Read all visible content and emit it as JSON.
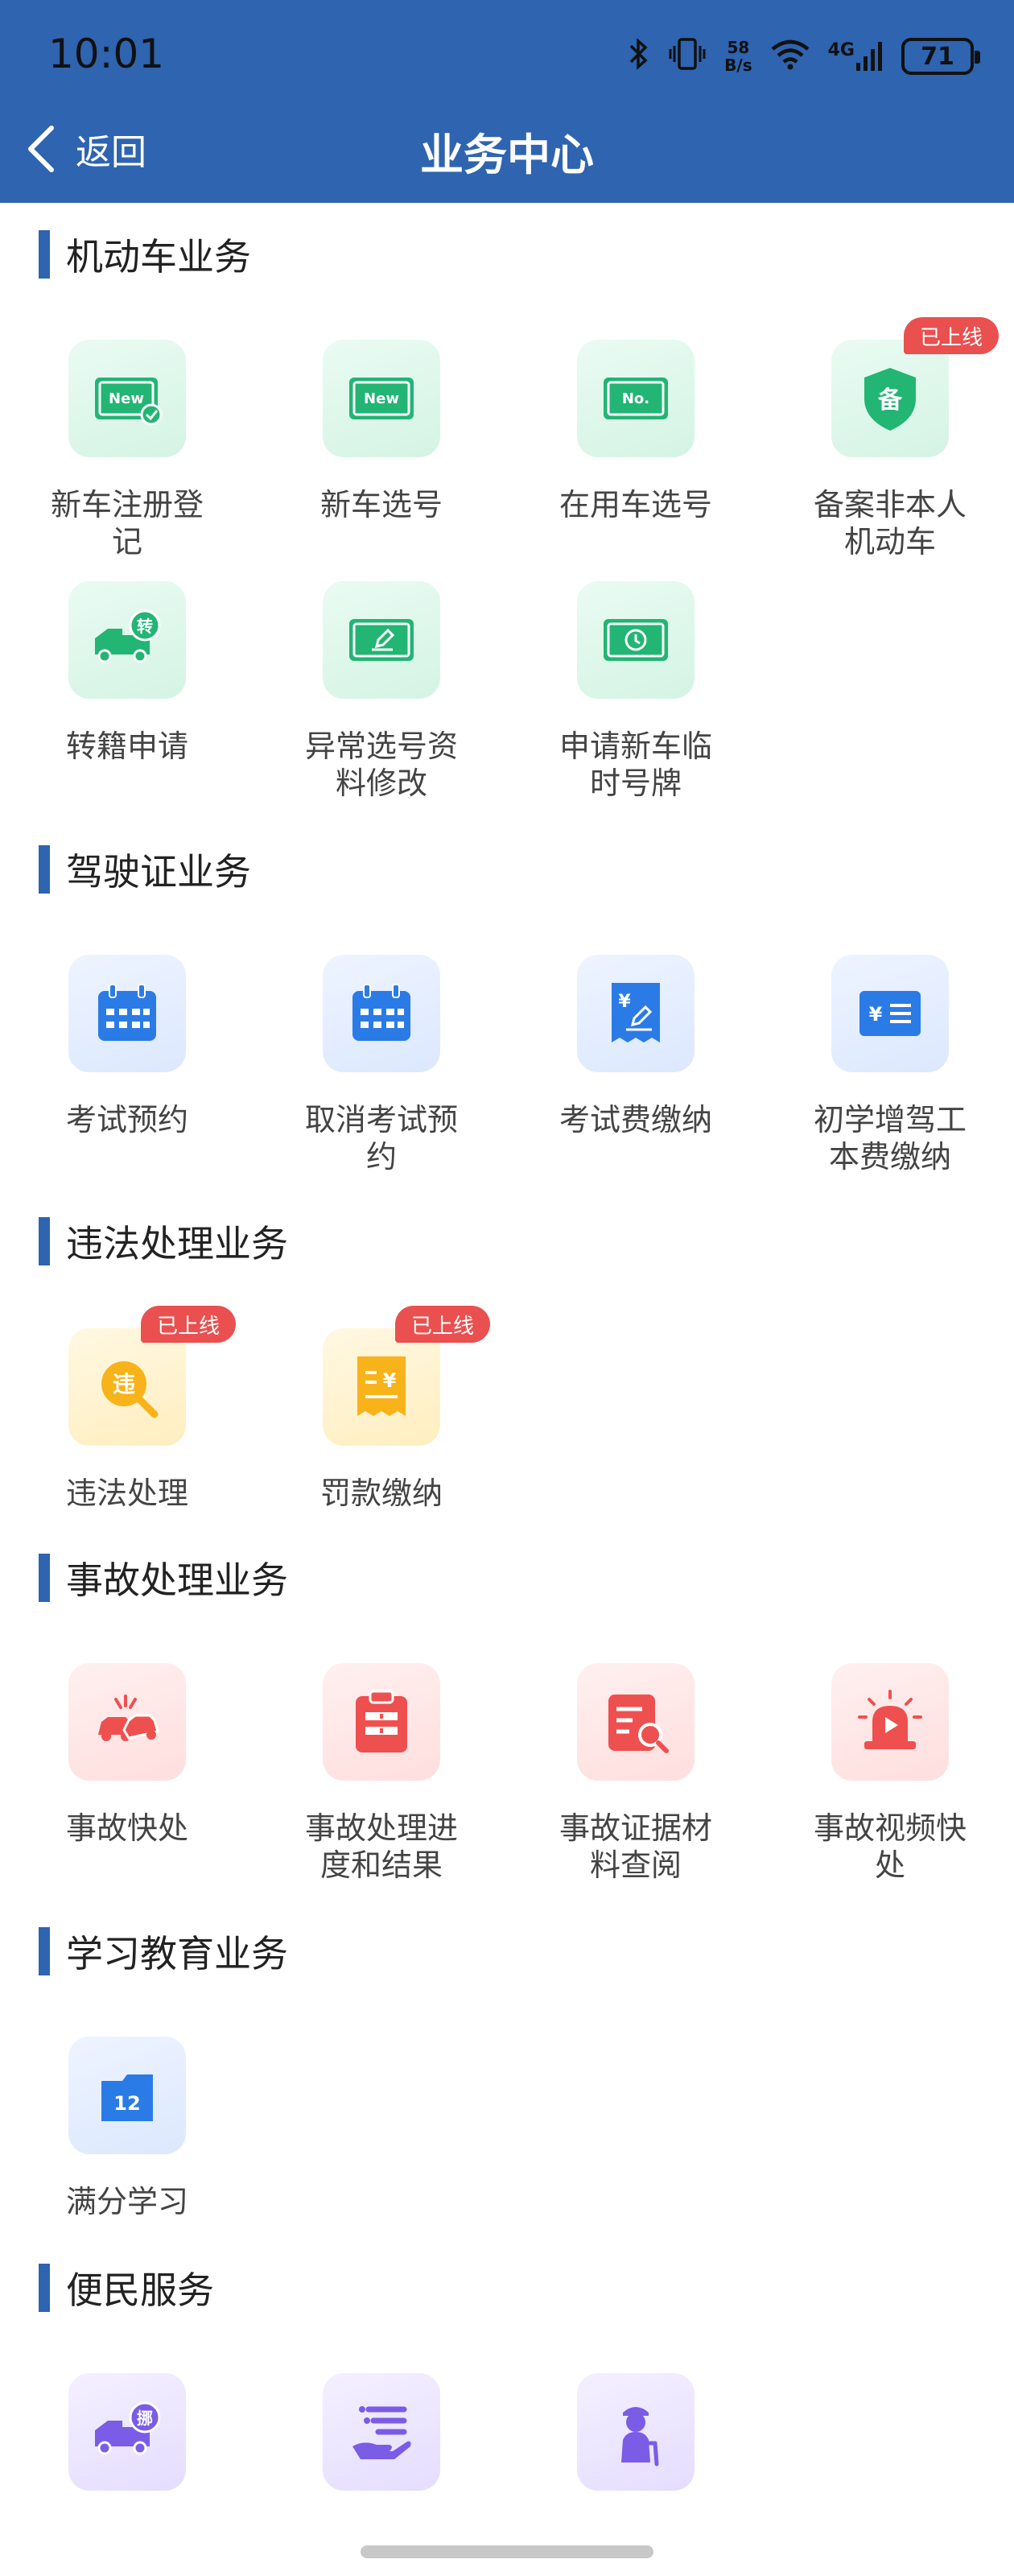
{
  "status_bar": {
    "time": "10:01",
    "bluetooth_icon": "bluetooth-icon",
    "vibrate_icon": "vibrate-icon",
    "net_speed_value": "58",
    "net_speed_unit": "B/s",
    "wifi_icon": "wifi-icon",
    "signal_label": "4G",
    "battery": "71"
  },
  "header": {
    "back_label": "返回",
    "title": "业务中心",
    "accent_color": "#2e64b0"
  },
  "badge_text": "已上线",
  "sections": [
    {
      "title": "机动车业务",
      "items": [
        {
          "label": "新车注册登记",
          "icon": "new-plate-check-icon",
          "color": "green",
          "badge": false
        },
        {
          "label": "新车选号",
          "icon": "new-plate-icon",
          "color": "green",
          "badge": false
        },
        {
          "label": "在用车选号",
          "icon": "number-plate-icon",
          "color": "green",
          "badge": false
        },
        {
          "label": "备案非本人机动车",
          "icon": "shield-record-icon",
          "color": "green",
          "badge": true
        },
        {
          "label": "转籍申请",
          "icon": "truck-transfer-icon",
          "color": "green",
          "badge": false
        },
        {
          "label": "异常选号资料修改",
          "icon": "plate-edit-icon",
          "color": "green",
          "badge": false
        },
        {
          "label": "申请新车临时号牌",
          "icon": "plate-clock-icon",
          "color": "green",
          "badge": false
        }
      ]
    },
    {
      "title": "驾驶证业务",
      "items": [
        {
          "label": "考试预约",
          "icon": "calendar-icon",
          "color": "blue",
          "badge": false
        },
        {
          "label": "取消考试预约",
          "icon": "calendar-cancel-icon",
          "color": "blue",
          "badge": false
        },
        {
          "label": "考试费缴纳",
          "icon": "fee-receipt-icon",
          "color": "blue",
          "badge": false
        },
        {
          "label": "初学增驾工本费缴纳",
          "icon": "fee-card-icon",
          "color": "blue",
          "badge": false
        }
      ]
    },
    {
      "title": "违法处理业务",
      "items": [
        {
          "label": "违法处理",
          "icon": "violation-search-icon",
          "color": "yellow",
          "badge": true
        },
        {
          "label": "罚款缴纳",
          "icon": "fine-receipt-icon",
          "color": "yellow",
          "badge": true
        }
      ]
    },
    {
      "title": "事故处理业务",
      "items": [
        {
          "label": "事故快处",
          "icon": "car-crash-icon",
          "color": "red",
          "badge": false
        },
        {
          "label": "事故处理进度和结果",
          "icon": "clipboard-progress-icon",
          "color": "red",
          "badge": false
        },
        {
          "label": "事故证据材料查阅",
          "icon": "document-search-icon",
          "color": "red",
          "badge": false
        },
        {
          "label": "事故视频快处",
          "icon": "alarm-video-icon",
          "color": "red",
          "badge": false
        }
      ]
    },
    {
      "title": "学习教育业务",
      "items": [
        {
          "label": "满分学习",
          "icon": "study-calendar-icon",
          "color": "blue",
          "badge": false
        }
      ]
    },
    {
      "title": "便民服务",
      "items": [
        {
          "label": "",
          "icon": "truck-move-icon",
          "color": "purple",
          "badge": false
        },
        {
          "label": "",
          "icon": "hand-list-icon",
          "color": "purple",
          "badge": false
        },
        {
          "label": "",
          "icon": "elderly-person-icon",
          "color": "purple",
          "badge": false
        }
      ]
    }
  ]
}
